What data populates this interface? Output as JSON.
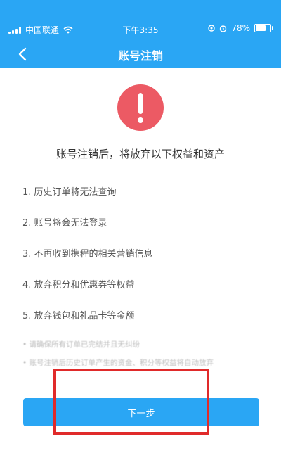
{
  "status_bar": {
    "carrier": "中国联通",
    "time": "下午3:35",
    "battery": "78%",
    "battery_fraction": 0.78
  },
  "nav": {
    "title": "账号注销",
    "back_icon": "chevron-left-icon"
  },
  "alert": {
    "icon": "exclamation-icon",
    "color": "#ec5a64",
    "headline": "账号注销后，将放弃以下权益和资产"
  },
  "items": [
    "1. 历史订单将无法查询",
    "2. 账号将会无法登录",
    "3. 不再收到携程的相关营销信息",
    "4. 放弃积分和优惠券等权益",
    "5. 放弃钱包和礼品卡等金额"
  ],
  "notes": [
    "• 请确保所有订单已完结并且无纠纷",
    "• 账号注销后历史订单产生的资金、积分等权益将自动放弃"
  ],
  "button": {
    "label": "下一步"
  },
  "colors": {
    "brand": "#2aa6f4",
    "alert": "#ec5a64",
    "annotation": "#e02a2a"
  }
}
